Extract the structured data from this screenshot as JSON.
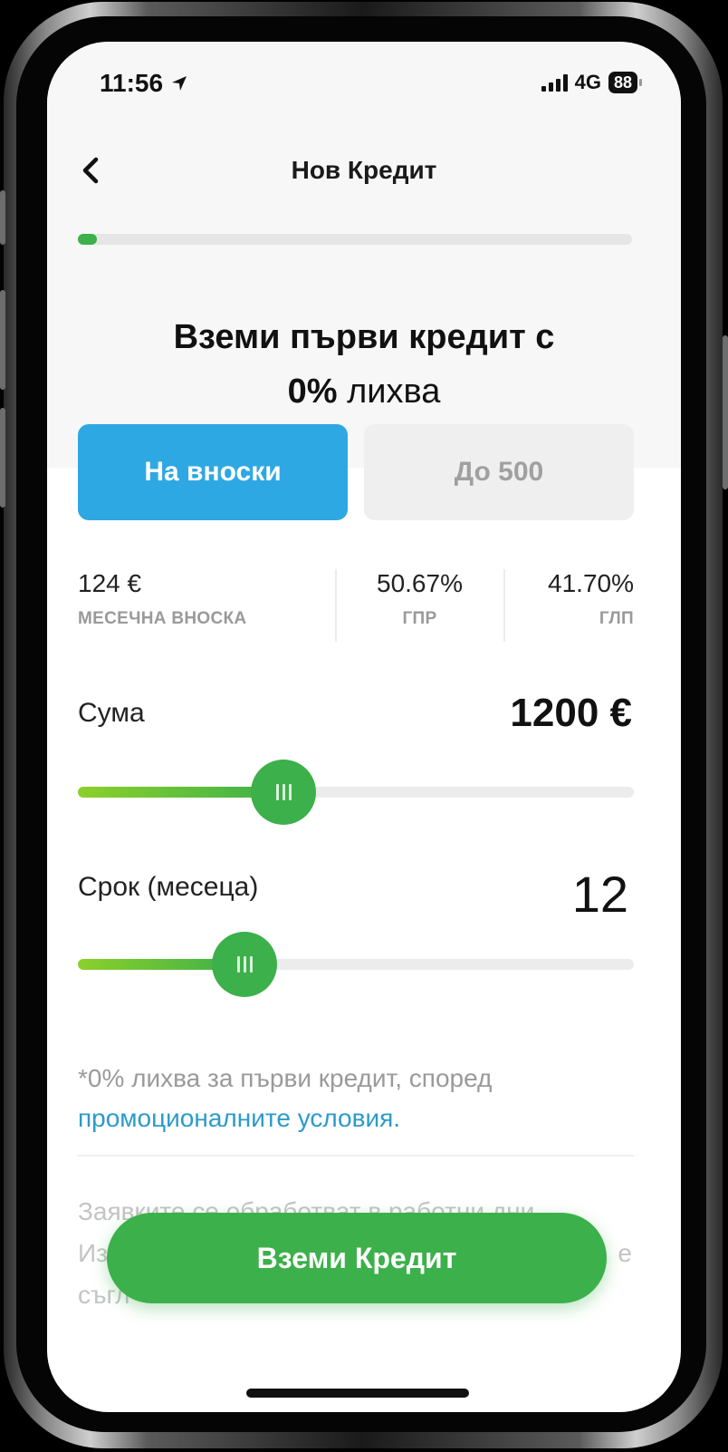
{
  "status_bar": {
    "time": "11:56",
    "network": "4G",
    "battery": "88"
  },
  "nav": {
    "title": "Нов Кредит",
    "back_icon": "chevron-left-icon"
  },
  "progress": {
    "fraction": 0.035,
    "color": "#3cb04a"
  },
  "headline": {
    "line1": "Вземи първи кредит с",
    "line2_bold": "0%",
    "line2_rest": " лихва"
  },
  "tabs": [
    {
      "label": "На вноски",
      "active": true
    },
    {
      "label": "До 500",
      "active": false
    }
  ],
  "stats": [
    {
      "value": "124 €",
      "label": "МЕСЕЧНА ВНОСКА"
    },
    {
      "value": "50.67%",
      "label": "ГПР"
    },
    {
      "value": "41.70%",
      "label": "ГЛП"
    }
  ],
  "amount": {
    "label": "Сума",
    "value": "1200 €",
    "slider_fraction": 0.37
  },
  "term": {
    "label": "Срок (месеца)",
    "value": "12",
    "slider_fraction": 0.3
  },
  "note": {
    "text": "*0% лихва за първи кредит, според",
    "link": "промоционалните условия."
  },
  "disclaimer": {
    "line1": "Заявките се обработват в работни дни.",
    "line2": "Из",
    "line2_end": "е",
    "line3": "съгл"
  },
  "cta": {
    "label": "Вземи Кредит"
  },
  "colors": {
    "accent_blue": "#2ea8e2",
    "accent_green": "#3cb04a",
    "link": "#2b9bc9"
  }
}
